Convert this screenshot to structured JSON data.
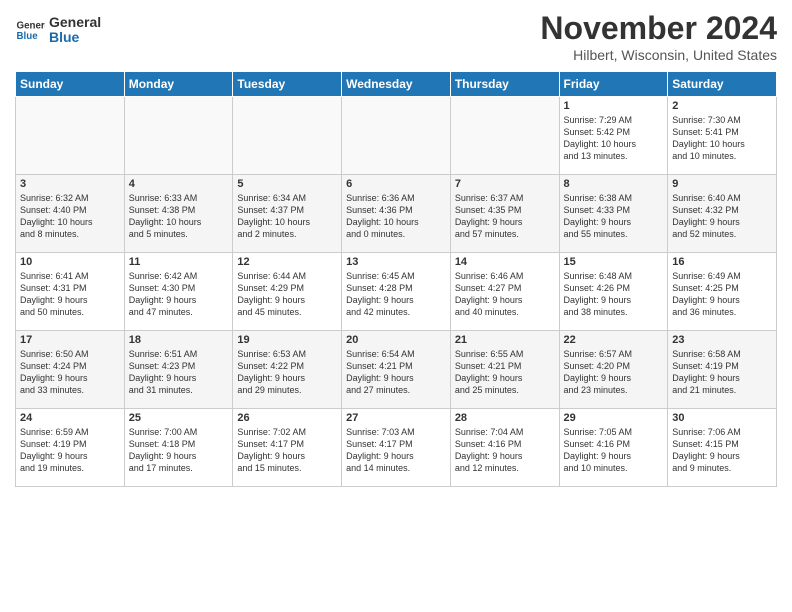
{
  "header": {
    "logo_line1": "General",
    "logo_line2": "Blue",
    "month": "November 2024",
    "location": "Hilbert, Wisconsin, United States"
  },
  "weekdays": [
    "Sunday",
    "Monday",
    "Tuesday",
    "Wednesday",
    "Thursday",
    "Friday",
    "Saturday"
  ],
  "weeks": [
    [
      {
        "day": "",
        "info": ""
      },
      {
        "day": "",
        "info": ""
      },
      {
        "day": "",
        "info": ""
      },
      {
        "day": "",
        "info": ""
      },
      {
        "day": "",
        "info": ""
      },
      {
        "day": "1",
        "info": "Sunrise: 7:29 AM\nSunset: 5:42 PM\nDaylight: 10 hours\nand 13 minutes."
      },
      {
        "day": "2",
        "info": "Sunrise: 7:30 AM\nSunset: 5:41 PM\nDaylight: 10 hours\nand 10 minutes."
      }
    ],
    [
      {
        "day": "3",
        "info": "Sunrise: 6:32 AM\nSunset: 4:40 PM\nDaylight: 10 hours\nand 8 minutes."
      },
      {
        "day": "4",
        "info": "Sunrise: 6:33 AM\nSunset: 4:38 PM\nDaylight: 10 hours\nand 5 minutes."
      },
      {
        "day": "5",
        "info": "Sunrise: 6:34 AM\nSunset: 4:37 PM\nDaylight: 10 hours\nand 2 minutes."
      },
      {
        "day": "6",
        "info": "Sunrise: 6:36 AM\nSunset: 4:36 PM\nDaylight: 10 hours\nand 0 minutes."
      },
      {
        "day": "7",
        "info": "Sunrise: 6:37 AM\nSunset: 4:35 PM\nDaylight: 9 hours\nand 57 minutes."
      },
      {
        "day": "8",
        "info": "Sunrise: 6:38 AM\nSunset: 4:33 PM\nDaylight: 9 hours\nand 55 minutes."
      },
      {
        "day": "9",
        "info": "Sunrise: 6:40 AM\nSunset: 4:32 PM\nDaylight: 9 hours\nand 52 minutes."
      }
    ],
    [
      {
        "day": "10",
        "info": "Sunrise: 6:41 AM\nSunset: 4:31 PM\nDaylight: 9 hours\nand 50 minutes."
      },
      {
        "day": "11",
        "info": "Sunrise: 6:42 AM\nSunset: 4:30 PM\nDaylight: 9 hours\nand 47 minutes."
      },
      {
        "day": "12",
        "info": "Sunrise: 6:44 AM\nSunset: 4:29 PM\nDaylight: 9 hours\nand 45 minutes."
      },
      {
        "day": "13",
        "info": "Sunrise: 6:45 AM\nSunset: 4:28 PM\nDaylight: 9 hours\nand 42 minutes."
      },
      {
        "day": "14",
        "info": "Sunrise: 6:46 AM\nSunset: 4:27 PM\nDaylight: 9 hours\nand 40 minutes."
      },
      {
        "day": "15",
        "info": "Sunrise: 6:48 AM\nSunset: 4:26 PM\nDaylight: 9 hours\nand 38 minutes."
      },
      {
        "day": "16",
        "info": "Sunrise: 6:49 AM\nSunset: 4:25 PM\nDaylight: 9 hours\nand 36 minutes."
      }
    ],
    [
      {
        "day": "17",
        "info": "Sunrise: 6:50 AM\nSunset: 4:24 PM\nDaylight: 9 hours\nand 33 minutes."
      },
      {
        "day": "18",
        "info": "Sunrise: 6:51 AM\nSunset: 4:23 PM\nDaylight: 9 hours\nand 31 minutes."
      },
      {
        "day": "19",
        "info": "Sunrise: 6:53 AM\nSunset: 4:22 PM\nDaylight: 9 hours\nand 29 minutes."
      },
      {
        "day": "20",
        "info": "Sunrise: 6:54 AM\nSunset: 4:21 PM\nDaylight: 9 hours\nand 27 minutes."
      },
      {
        "day": "21",
        "info": "Sunrise: 6:55 AM\nSunset: 4:21 PM\nDaylight: 9 hours\nand 25 minutes."
      },
      {
        "day": "22",
        "info": "Sunrise: 6:57 AM\nSunset: 4:20 PM\nDaylight: 9 hours\nand 23 minutes."
      },
      {
        "day": "23",
        "info": "Sunrise: 6:58 AM\nSunset: 4:19 PM\nDaylight: 9 hours\nand 21 minutes."
      }
    ],
    [
      {
        "day": "24",
        "info": "Sunrise: 6:59 AM\nSunset: 4:19 PM\nDaylight: 9 hours\nand 19 minutes."
      },
      {
        "day": "25",
        "info": "Sunrise: 7:00 AM\nSunset: 4:18 PM\nDaylight: 9 hours\nand 17 minutes."
      },
      {
        "day": "26",
        "info": "Sunrise: 7:02 AM\nSunset: 4:17 PM\nDaylight: 9 hours\nand 15 minutes."
      },
      {
        "day": "27",
        "info": "Sunrise: 7:03 AM\nSunset: 4:17 PM\nDaylight: 9 hours\nand 14 minutes."
      },
      {
        "day": "28",
        "info": "Sunrise: 7:04 AM\nSunset: 4:16 PM\nDaylight: 9 hours\nand 12 minutes."
      },
      {
        "day": "29",
        "info": "Sunrise: 7:05 AM\nSunset: 4:16 PM\nDaylight: 9 hours\nand 10 minutes."
      },
      {
        "day": "30",
        "info": "Sunrise: 7:06 AM\nSunset: 4:15 PM\nDaylight: 9 hours\nand 9 minutes."
      }
    ]
  ]
}
